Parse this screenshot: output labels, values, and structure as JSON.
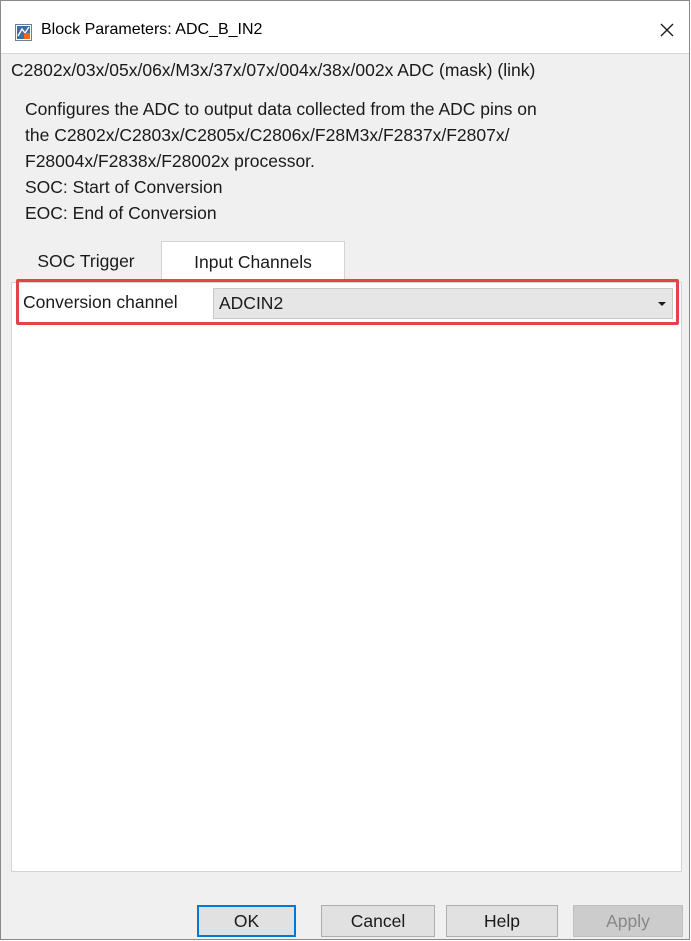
{
  "window": {
    "title": "Block Parameters: ADC_B_IN2",
    "close_glyph": "×"
  },
  "mask": {
    "title": "C2802x/03x/05x/06x/M3x/37x/07x/004x/38x/002x ADC (mask) (link)",
    "description_lines": [
      "Configures the ADC to output data collected from the ADC pins on",
      "the C2802x/C2803x/C2805x/C2806x/F28M3x/F2837x/F2807x/",
      "F28004x/F2838x/F28002x processor.",
      "SOC: Start of Conversion",
      "EOC: End of Conversion"
    ]
  },
  "tabs": [
    {
      "label": "SOC Trigger",
      "active": false
    },
    {
      "label": "Input Channels",
      "active": true
    }
  ],
  "params": {
    "conversion_channel_label": "Conversion channel",
    "conversion_channel_value": "ADCIN2"
  },
  "buttons": {
    "ok": "OK",
    "cancel": "Cancel",
    "help": "Help",
    "apply": "Apply"
  },
  "colors": {
    "highlight": "#e5434a",
    "default_button_border": "#0078d7"
  },
  "icons": {
    "app": "simulink-block-icon",
    "close": "close-icon",
    "dropdown": "chevron-down-icon"
  }
}
